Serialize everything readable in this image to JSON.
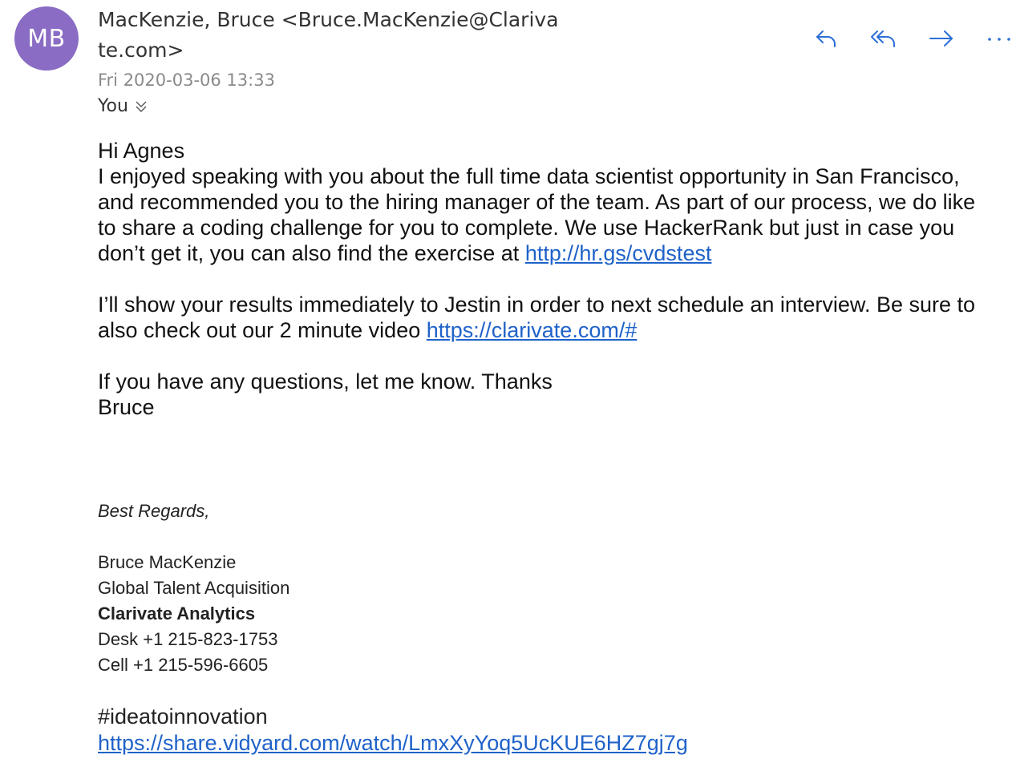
{
  "avatar": {
    "initials": "MB",
    "color": "#8a6cc4"
  },
  "header": {
    "from": "MacKenzie, Bruce <Bruce.MacKenzie@Clarivate.com>",
    "date": "Fri 2020-03-06 13:33",
    "to": "You"
  },
  "actions": [
    {
      "name": "reply",
      "icon": "reply-icon"
    },
    {
      "name": "reply-all",
      "icon": "reply-all-icon"
    },
    {
      "name": "forward",
      "icon": "forward-icon"
    },
    {
      "name": "more",
      "icon": "more-icon"
    }
  ],
  "accent_color": "#1f62c9",
  "message": {
    "greeting": "Hi Agnes",
    "para1": "I enjoyed speaking with you about the full time data scientist opportunity in San Francisco, and recommended you to the hiring manager of the team.  As part of our process, we do like to share a coding challenge for you to complete.  We use HackerRank but just in case you don’t get it, you can also find the exercise at",
    "link1": "http://hr.gs/cvdstest",
    "para2": "I’ll show your results immediately to Jestin in order to next schedule an interview.  Be sure to also check out our 2 minute video",
    "link2": "https://clarivate.com/#",
    "para3": "If you have any questions, let me know.  Thanks",
    "sign_name": "Bruce"
  },
  "signature": {
    "closing": "Best Regards,",
    "name": "Bruce MacKenzie",
    "title": "Global Talent Acquisition",
    "company": "Clarivate Analytics",
    "desk": "Desk +1 215-823-1753",
    "cell": "Cell +1 215-596-6605",
    "hashtag": "#ideatoinnovation",
    "video_link": "https://share.vidyard.com/watch/LmxXyYoq5UcKUE6HZ7gj7g"
  }
}
